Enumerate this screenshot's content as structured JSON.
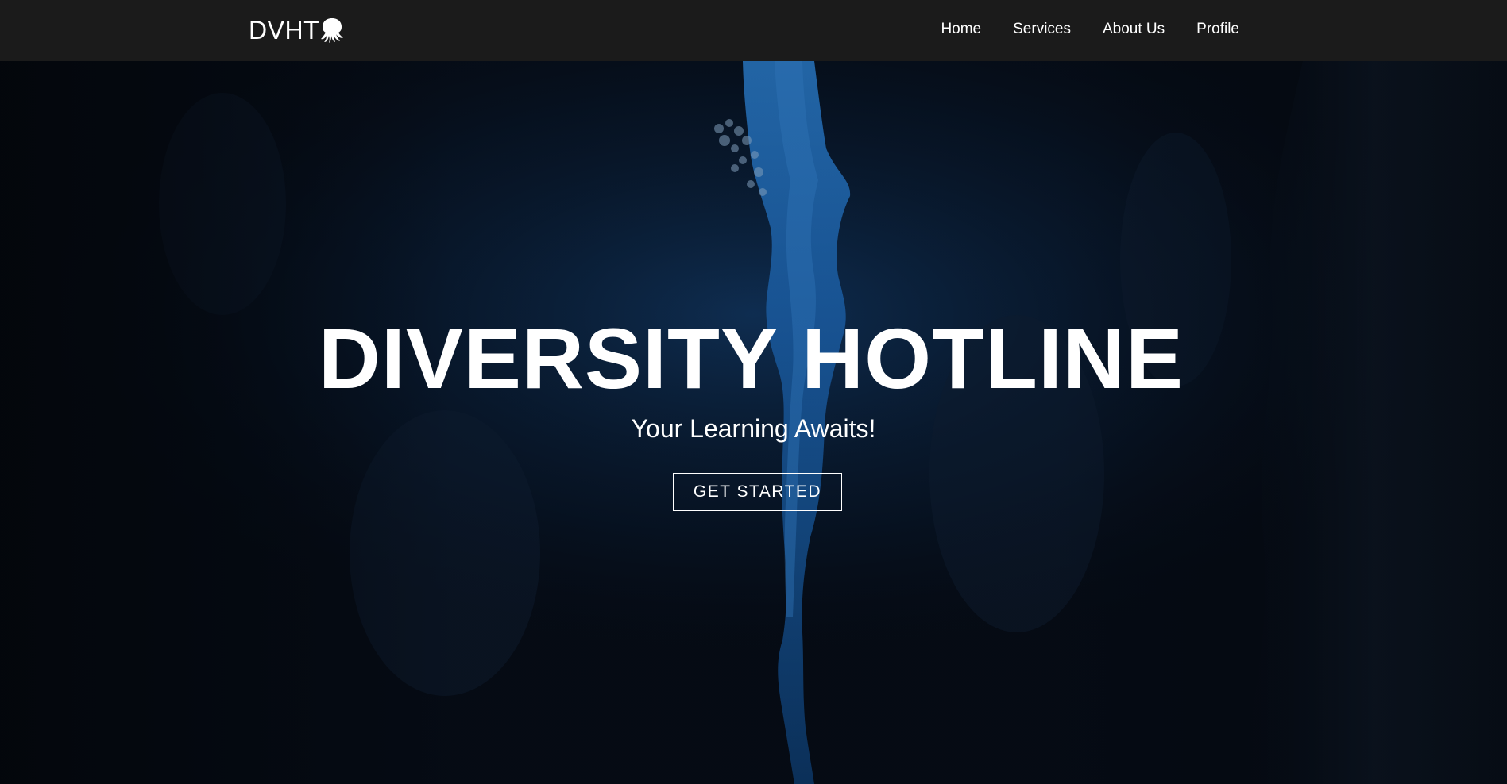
{
  "header": {
    "logo_text": "DVHT",
    "logo_icon": "octopus-icon",
    "nav": [
      {
        "label": "Home"
      },
      {
        "label": "Services"
      },
      {
        "label": "About Us"
      },
      {
        "label": "Profile"
      }
    ]
  },
  "hero": {
    "title": "DIVERSITY HOTLINE",
    "subtitle": "Your Learning Awaits!",
    "cta_label": "GET STARTED",
    "background": "underwater-canyon-image"
  },
  "colors": {
    "navbar": "#1b1b1b",
    "hero_dark": "#050a12",
    "water_blue": "#1f6fc0",
    "text": "#ffffff"
  }
}
